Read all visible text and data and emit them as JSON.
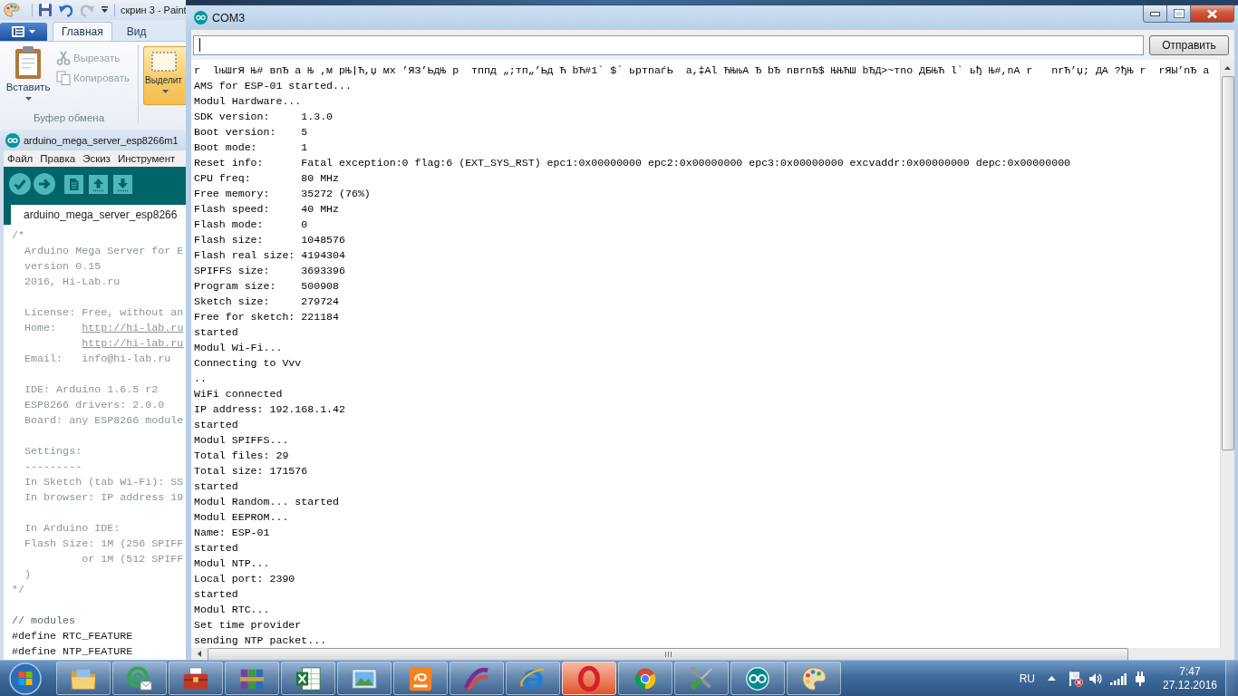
{
  "paint_window": {
    "title": "скрин 3 - Paint",
    "quick_access": [
      {
        "kind": "save",
        "disabled": false
      },
      {
        "kind": "undo",
        "disabled": false
      },
      {
        "kind": "redo",
        "disabled": true
      }
    ],
    "ribbon_tabs": [
      {
        "label": "Главная",
        "selected": true
      },
      {
        "label": "Вид",
        "selected": false
      }
    ],
    "clipboard_group": {
      "label": "Буфер обмена",
      "paste": "Вставить",
      "actions": [
        {
          "kind": "cut",
          "label": "Вырезать",
          "disabled": true
        },
        {
          "kind": "copy",
          "label": "Копировать",
          "disabled": true
        }
      ]
    },
    "select_button": "Выделит"
  },
  "arduino_window": {
    "title": "arduino_mega_server_esp8266m1",
    "menu": [
      "Файл",
      "Правка",
      "Эскиз",
      "Инструмент"
    ],
    "tabs": [
      {
        "label": "arduino_mega_server_esp8266",
        "selected": true
      }
    ],
    "code": [
      {
        "kind": "comment",
        "text": "/*"
      },
      {
        "kind": "comment",
        "text": "  Arduino Mega Server for E"
      },
      {
        "kind": "comment",
        "text": "  version 0.15"
      },
      {
        "kind": "comment",
        "text": "  2016, Hi-Lab.ru"
      },
      {
        "kind": "blank"
      },
      {
        "kind": "comment",
        "text": "  License: Free, without an"
      },
      {
        "kind": "comment",
        "text": "  Home:",
        "link": "    http://hi-lab.ru"
      },
      {
        "kind": "comment",
        "link": "           http://hi-lab.ru"
      },
      {
        "kind": "comment",
        "text": "  Email:   info@hi-lab.ru"
      },
      {
        "kind": "blank"
      },
      {
        "kind": "comment",
        "text": "  IDE: Arduino 1.6.5 r2"
      },
      {
        "kind": "comment",
        "text": "  ESP8266 drivers: 2.0.0"
      },
      {
        "kind": "comment",
        "text": "  Board: any ESP8266 module"
      },
      {
        "kind": "blank"
      },
      {
        "kind": "comment",
        "text": "  Settings:"
      },
      {
        "kind": "comment",
        "text": "  ---------"
      },
      {
        "kind": "comment",
        "text": "  In Sketch (tab Wi-Fi): SS"
      },
      {
        "kind": "comment",
        "text": "  In browser: IP address 19"
      },
      {
        "kind": "blank"
      },
      {
        "kind": "comment",
        "text": "  In Arduino IDE:"
      },
      {
        "kind": "comment",
        "text": "  Flash Size: 1M (256 SPIFF"
      },
      {
        "kind": "comment",
        "text": "           or 1M (512 SPIFF"
      },
      {
        "kind": "comment",
        "text": "  )"
      },
      {
        "kind": "comment",
        "text": "*/"
      },
      {
        "kind": "blank"
      },
      {
        "kind": "line_comment",
        "text": "// modules"
      },
      {
        "kind": "code",
        "text": "#define RTC_FEATURE"
      },
      {
        "kind": "code",
        "text": "#define NTP_FEATURE"
      }
    ]
  },
  "serial_monitor": {
    "title": "COM3",
    "input": {
      "focused": true
    },
    "send_button": "Отправить",
    "output": [
      "r  lњШrЯ Њ# вnЂ а Њ ,м рЊ|Ћ,џ мх ’ЯЗ’ЬдЊ р  тппд „;тп„’Ьд Ћ bЋ#1` $` ьртnаѓЬ  а,‡Аl ЋЊњА Ђ bЂ nвrnЂ$ ЊЊЋШ bЂД>~тno ДБЊЋ l` ьђ Њ#,nА r   nrЋ’џ; ДА ?ђЊ r  rЯЫ’nЂ а",
      "AMS for ESP-01 started...",
      "Modul Hardware...",
      "SDK version:     1.3.0",
      "Boot version:    5",
      "Boot mode:       1",
      "Reset info:      Fatal exception:0 flag:6 (EXT_SYS_RST) epc1:0x00000000 epc2:0x00000000 epc3:0x00000000 excvaddr:0x00000000 depc:0x00000000",
      "CPU freq:        80 MHz",
      "Free memory:     35272 (76%)",
      "Flash speed:     40 MHz",
      "Flash mode:      0",
      "Flash size:      1048576",
      "Flash real size: 4194304",
      "SPIFFS size:     3693396",
      "Program size:    500908",
      "Sketch size:     279724",
      "Free for sketch: 221184",
      "started",
      "Modul Wi-Fi...",
      "Connecting to Vvv",
      "..",
      "WiFi connected",
      "IP address: 192.168.1.42",
      "started",
      "Modul SPIFFS...",
      "Total files: 29",
      "Total size: 171576",
      "started",
      "Modul Random... started",
      "Modul EEPROM...",
      "Name: ESP-01",
      "started",
      "Modul NTP...",
      "Local port: 2390",
      "started",
      "Modul RTC...",
      "Set time provider",
      "sending NTP packet..."
    ]
  },
  "taskbar": {
    "buttons": [
      {
        "kind": "explorer",
        "highlighted": false
      },
      {
        "kind": "mail",
        "highlighted": false
      },
      {
        "kind": "toolbox",
        "highlighted": false
      },
      {
        "kind": "archiver",
        "highlighted": false
      },
      {
        "kind": "spreadsheet",
        "highlighted": false
      },
      {
        "kind": "photos",
        "highlighted": false
      },
      {
        "kind": "pdf",
        "highlighted": false
      },
      {
        "kind": "arc",
        "highlighted": false
      },
      {
        "kind": "ie",
        "highlighted": false
      },
      {
        "kind": "opera",
        "highlighted": true
      },
      {
        "kind": "chrome",
        "highlighted": false
      },
      {
        "kind": "tools",
        "highlighted": false
      },
      {
        "kind": "arduino",
        "highlighted": false
      },
      {
        "kind": "paint",
        "highlighted": false
      }
    ],
    "language": "RU",
    "time": "7:47",
    "date": "27.12.2016"
  }
}
